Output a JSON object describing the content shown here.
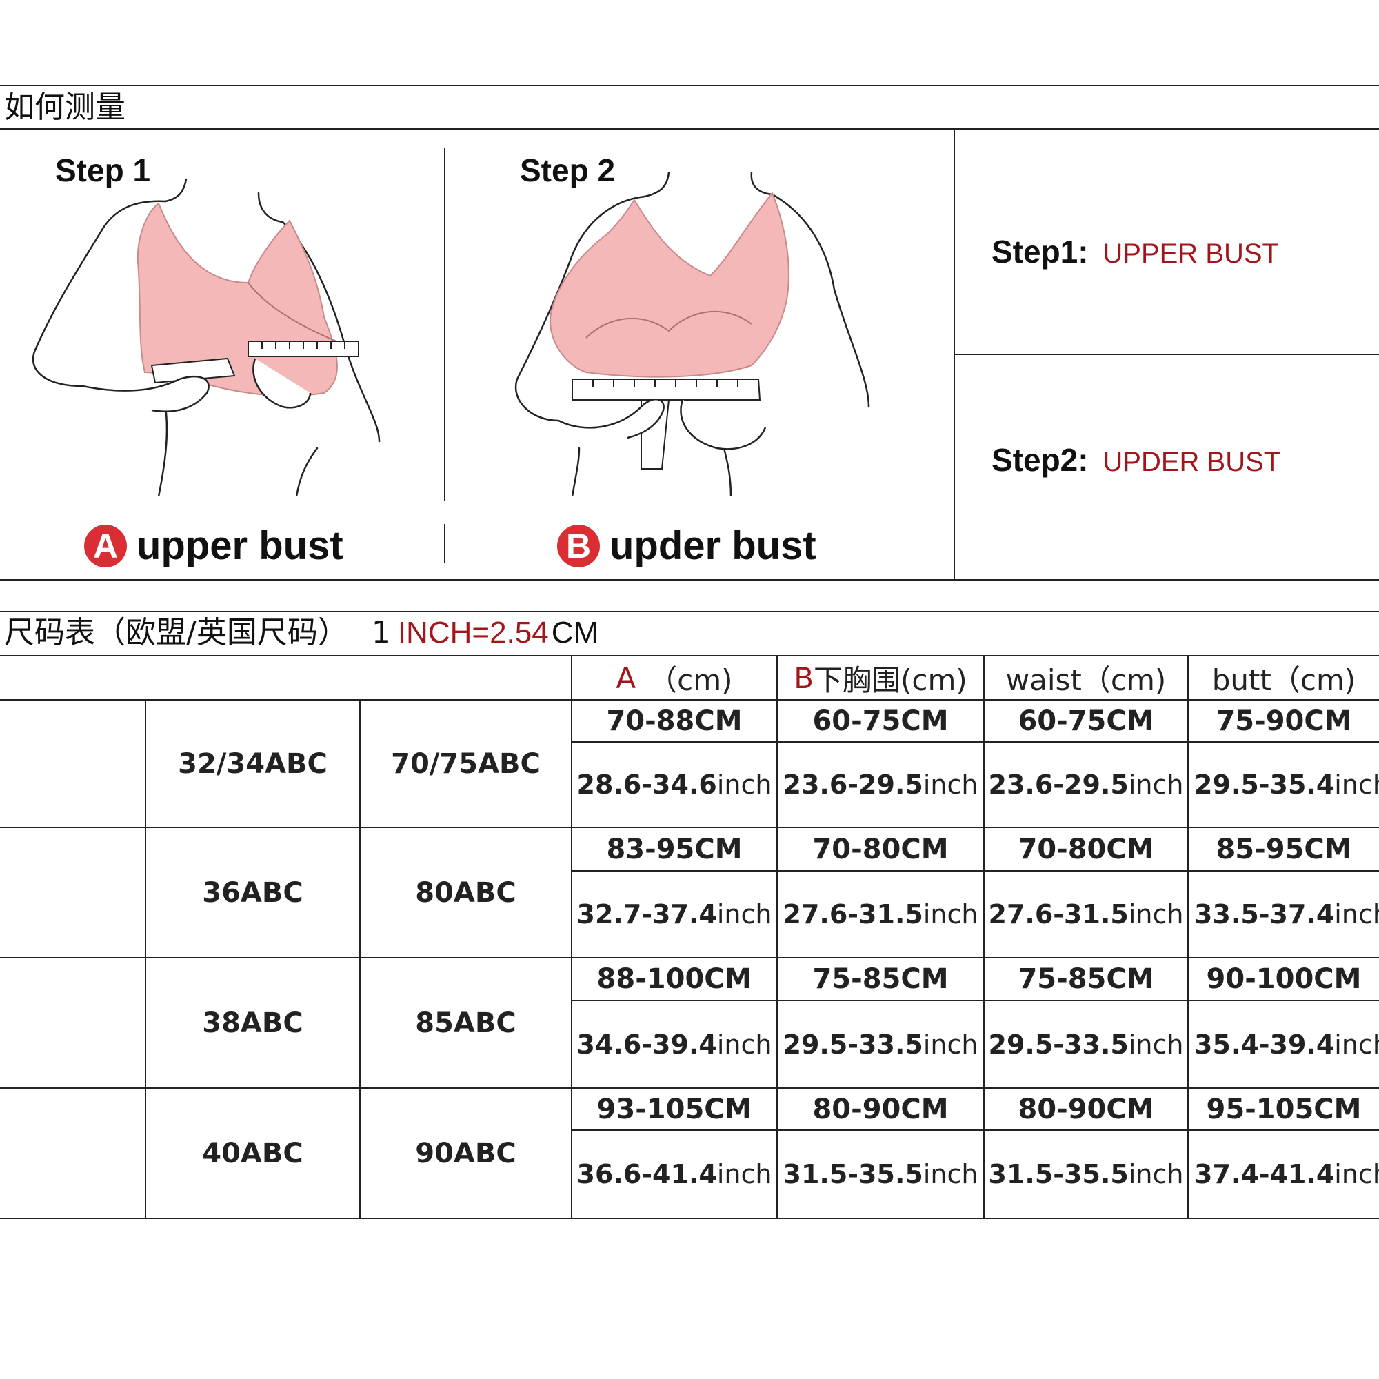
{
  "measure": {
    "title": "如何测量",
    "step1_title": "Step 1",
    "step2_title": "Step 2",
    "label_a_letter": "A",
    "label_a_text": "upper bust",
    "label_b_letter": "B",
    "label_b_text": "upder bust",
    "side_step1_label": "Step1:",
    "side_step1_value": "UPPER BUST",
    "side_step2_label": "Step2:",
    "side_step2_value": "UPDER BUST"
  },
  "chart": {
    "title": "尺码表（欧盟/英国尺码）",
    "conv_prefix": "1",
    "conv_red": "INCH=2.54",
    "conv_suffix": "CM",
    "headers": {
      "a_letter": "A",
      "a_unit": "（cm)",
      "b_letter": "B",
      "b_text": "下胸围(cm)",
      "waist": "waist（cm)",
      "butt": "butt（cm)"
    },
    "rows": [
      {
        "us": "32/34ABC",
        "eu": "70/75ABC",
        "a_cm": "70-88CM",
        "b_cm": "60-75CM",
        "w_cm": "60-75CM",
        "t_cm": "75-90CM",
        "a_in": "28.6-34.6",
        "b_in": "23.6-29.5",
        "w_in": "23.6-29.5",
        "t_in": "29.5-35.4"
      },
      {
        "us": "36ABC",
        "eu": "80ABC",
        "a_cm": "83-95CM",
        "b_cm": "70-80CM",
        "w_cm": "70-80CM",
        "t_cm": "85-95CM",
        "a_in": "32.7-37.4",
        "b_in": "27.6-31.5",
        "w_in": "27.6-31.5",
        "t_in": "33.5-37.4"
      },
      {
        "us": "38ABC",
        "eu": "85ABC",
        "a_cm": "88-100CM",
        "b_cm": "75-85CM",
        "w_cm": "75-85CM",
        "t_cm": "90-100CM",
        "a_in": "34.6-39.4",
        "b_in": "29.5-33.5",
        "w_in": "29.5-33.5",
        "t_in": "35.4-39.4"
      },
      {
        "us": "40ABC",
        "eu": "90ABC",
        "a_cm": "93-105CM",
        "b_cm": "80-90CM",
        "w_cm": "80-90CM",
        "t_cm": "95-105CM",
        "a_in": "36.6-41.4",
        "b_in": "31.5-35.5",
        "w_in": "31.5-35.5",
        "t_in": "37.4-41.4"
      }
    ],
    "inch_unit": "inch"
  },
  "colors": {
    "accent_red": "#a0161b",
    "badge_red": "#d92e33",
    "bra_pink": "#f4b8b8"
  }
}
